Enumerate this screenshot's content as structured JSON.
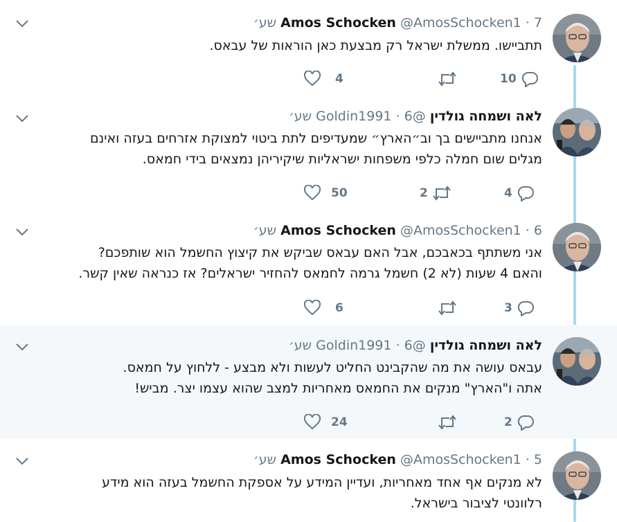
{
  "tweets": [
    {
      "name": "Amos Schocken",
      "handle": "@AmosSchocken1",
      "time": "7 שע׳",
      "lines": [
        "תתביישו. ממשלת ישראל רק מבצעת כאן הוראות של עבאס."
      ],
      "replies": "10",
      "retweets": "",
      "likes": "4",
      "avatar": "amos"
    },
    {
      "name": "לאה ושמחה גולדין",
      "handle": "@Goldin1991",
      "time": "6 שע׳",
      "lines": [
        "אנחנו מתביישים בך וב״הארץ״ שמעדיפים לתת ביטוי למצוקת אזרחים בעזה ואינם",
        "מגלים שום חמלה כלפי משפחות ישראליות שיקיריהן נמצאים בידי חמאס."
      ],
      "replies": "4",
      "retweets": "2",
      "likes": "50",
      "avatar": "goldin"
    },
    {
      "name": "Amos Schocken",
      "handle": "@AmosSchocken1",
      "time": "6 שע׳",
      "lines": [
        "אני משתתף בכאבכם, אבל האם עבאס שביקש את קיצוץ החשמל הוא שותפכם?",
        "והאם 4 שעות (לא 2) חשמל גרמה לחמאס להחזיר ישראלים? אז כנראה שאין קשר."
      ],
      "replies": "3",
      "retweets": "",
      "likes": "6",
      "avatar": "amos"
    },
    {
      "name": "לאה ושמחה גולדין",
      "handle": "@Goldin1991",
      "time": "6 שע׳",
      "lines": [
        "עבאס עושה את מה שהקבינט החליט לעשות ולא מבצע - ללחוץ על חמאס.",
        "אתה ו\"הארץ\" מנקים את החמאס מאחריות למצב שהוא עצמו יצר. מביש!"
      ],
      "replies": "2",
      "retweets": "",
      "likes": "24",
      "avatar": "goldin"
    },
    {
      "name": "Amos Schocken",
      "handle": "@AmosSchocken1",
      "time": "5 שע׳",
      "lines": [
        "לא מנקים אף אחד מאחריות, ועדיין המידע על אספקת החשמל בעזה הוא מידע",
        "רלוונטי לציבור בישראל."
      ],
      "replies": "",
      "retweets": "",
      "likes": "",
      "avatar": "amos"
    }
  ],
  "separator": "·",
  "colors": {
    "thread_line": "#a9d7f0",
    "muted": "#657786",
    "highlight_bg": "#f5f8fa"
  },
  "icons": {
    "reply": "reply-icon",
    "retweet": "retweet-icon",
    "like": "heart-icon",
    "menu": "chevron-down-icon"
  }
}
